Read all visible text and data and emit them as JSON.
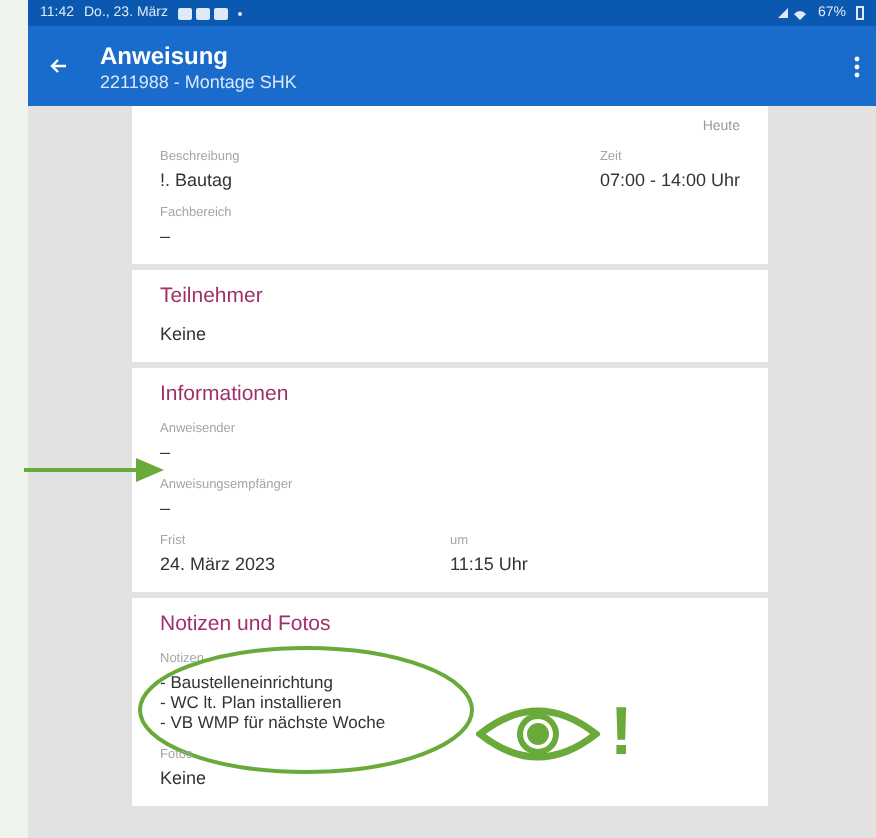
{
  "status_bar": {
    "time": "11:42",
    "date": "Do., 23. März",
    "battery": "67%"
  },
  "app_bar": {
    "title": "Anweisung",
    "subtitle": "2211988 - Montage SHK"
  },
  "sections": [
    {
      "tag": "Heute",
      "rows": [
        {
          "kind": "spread",
          "fields": [
            {
              "label": "Beschreibung",
              "value": "!. Bautag"
            },
            {
              "label": "Zeit",
              "value": "07:00 - 14:00 Uhr"
            }
          ]
        },
        {
          "kind": "spread",
          "fields": [
            {
              "label": "Fachbereich",
              "value": "–"
            }
          ]
        }
      ]
    },
    {
      "title": "Teilnehmer",
      "rows": [
        {
          "kind": "spread",
          "fields": [
            {
              "value": "Keine"
            }
          ]
        }
      ]
    },
    {
      "title": "Informationen",
      "rows": [
        {
          "kind": "spread",
          "fields": [
            {
              "label": "Anweisender",
              "value": "–"
            }
          ]
        },
        {
          "kind": "spread",
          "fields": [
            {
              "label": "Anweisungsempfänger",
              "value": "–"
            }
          ]
        },
        {
          "kind": "grid",
          "fields": [
            {
              "label": "Frist",
              "value": "24. März 2023"
            },
            {
              "label": "um",
              "value": "11:15 Uhr"
            }
          ]
        }
      ]
    },
    {
      "title": "Notizen und Fotos",
      "rows": [
        {
          "kind": "spread",
          "fields": [
            {
              "label": "Notizen",
              "lines": [
                "- Baustelleneinrichtung",
                "- WC lt. Plan installieren",
                "- VB WMP für nächste Woche"
              ],
              "highlighted": true
            }
          ]
        },
        {
          "kind": "spread",
          "fields": [
            {
              "label": "Fotos",
              "value": "Keine"
            }
          ]
        }
      ]
    }
  ],
  "annotation": {
    "mark": "!"
  }
}
